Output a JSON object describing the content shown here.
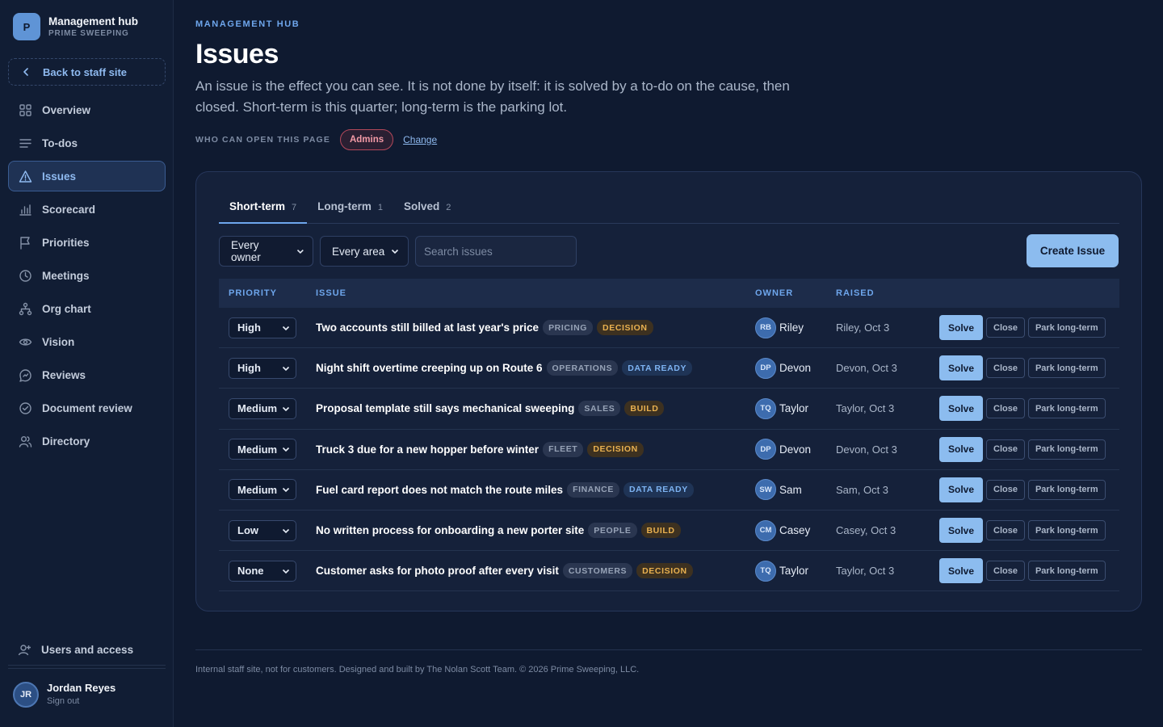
{
  "brand": {
    "logo_letter": "P",
    "name": "Management hub",
    "sub": "PRIME SWEEPING"
  },
  "back_link": "Back to staff site",
  "nav": [
    {
      "label": "Overview",
      "icon": "grid-icon",
      "active": false
    },
    {
      "label": "To-dos",
      "icon": "list-icon",
      "active": false
    },
    {
      "label": "Issues",
      "icon": "warning-icon",
      "active": true
    },
    {
      "label": "Scorecard",
      "icon": "bar-chart-icon",
      "active": false
    },
    {
      "label": "Priorities",
      "icon": "flag-icon",
      "active": false
    },
    {
      "label": "Meetings",
      "icon": "clock-icon",
      "active": false
    },
    {
      "label": "Org chart",
      "icon": "org-chart-icon",
      "active": false
    },
    {
      "label": "Vision",
      "icon": "eye-icon",
      "active": false
    },
    {
      "label": "Reviews",
      "icon": "chat-icon",
      "active": false
    },
    {
      "label": "Document review",
      "icon": "check-circle-icon",
      "active": false
    },
    {
      "label": "Directory",
      "icon": "people-icon",
      "active": false
    }
  ],
  "users_access": "Users and access",
  "profile": {
    "initials": "JR",
    "name": "Jordan Reyes",
    "signout": "Sign out"
  },
  "header": {
    "eyebrow": "MANAGEMENT HUB",
    "title": "Issues",
    "description": "An issue is the effect you can see. It is not done by itself: it is solved by a to-do on the cause, then closed. Short-term is this quarter; long-term is the parking lot.",
    "access_label": "WHO CAN OPEN THIS PAGE",
    "access_badge": "Admins",
    "change_link": "Change"
  },
  "tabs": [
    {
      "label": "Short-term",
      "count": "7",
      "active": true
    },
    {
      "label": "Long-term",
      "count": "1",
      "active": false
    },
    {
      "label": "Solved",
      "count": "2",
      "active": false
    }
  ],
  "filters": {
    "owner": "Every owner",
    "area": "Every area",
    "search_placeholder": "Search issues"
  },
  "create_button": "Create Issue",
  "table": {
    "columns": {
      "priority": "PRIORITY",
      "issue": "ISSUE",
      "owner": "OWNER",
      "raised": "RAISED"
    },
    "rows": [
      {
        "priority": "High",
        "title": "Two accounts still billed at last year's price",
        "area": "PRICING",
        "status": "DECISION",
        "status_kind": "decision",
        "owner_initials": "RB",
        "owner": "Riley",
        "raised": "Riley, Oct 3"
      },
      {
        "priority": "High",
        "title": "Night shift overtime creeping up on Route 6",
        "area": "OPERATIONS",
        "status": "DATA READY",
        "status_kind": "data",
        "owner_initials": "DP",
        "owner": "Devon",
        "raised": "Devon, Oct 3"
      },
      {
        "priority": "Medium",
        "title": "Proposal template still says mechanical sweeping",
        "area": "SALES",
        "status": "BUILD",
        "status_kind": "build",
        "owner_initials": "TQ",
        "owner": "Taylor",
        "raised": "Taylor, Oct 3"
      },
      {
        "priority": "Medium",
        "title": "Truck 3 due for a new hopper before winter",
        "area": "FLEET",
        "status": "DECISION",
        "status_kind": "decision",
        "owner_initials": "DP",
        "owner": "Devon",
        "raised": "Devon, Oct 3"
      },
      {
        "priority": "Medium",
        "title": "Fuel card report does not match the route miles",
        "area": "FINANCE",
        "status": "DATA READY",
        "status_kind": "data",
        "owner_initials": "SW",
        "owner": "Sam",
        "raised": "Sam, Oct 3"
      },
      {
        "priority": "Low",
        "title": "No written process for onboarding a new porter site",
        "area": "PEOPLE",
        "status": "BUILD",
        "status_kind": "build",
        "owner_initials": "CM",
        "owner": "Casey",
        "raised": "Casey, Oct 3"
      },
      {
        "priority": "None",
        "title": "Customer asks for photo proof after every visit",
        "area": "CUSTOMERS",
        "status": "DECISION",
        "status_kind": "decision",
        "owner_initials": "TQ",
        "owner": "Taylor",
        "raised": "Taylor, Oct 3"
      }
    ],
    "actions": {
      "solve": "Solve",
      "close": "Close",
      "park": "Park long-term"
    }
  },
  "footer": "Internal staff site, not for customers. Designed and built by The Nolan Scott Team. © 2026 Prime Sweeping, LLC."
}
